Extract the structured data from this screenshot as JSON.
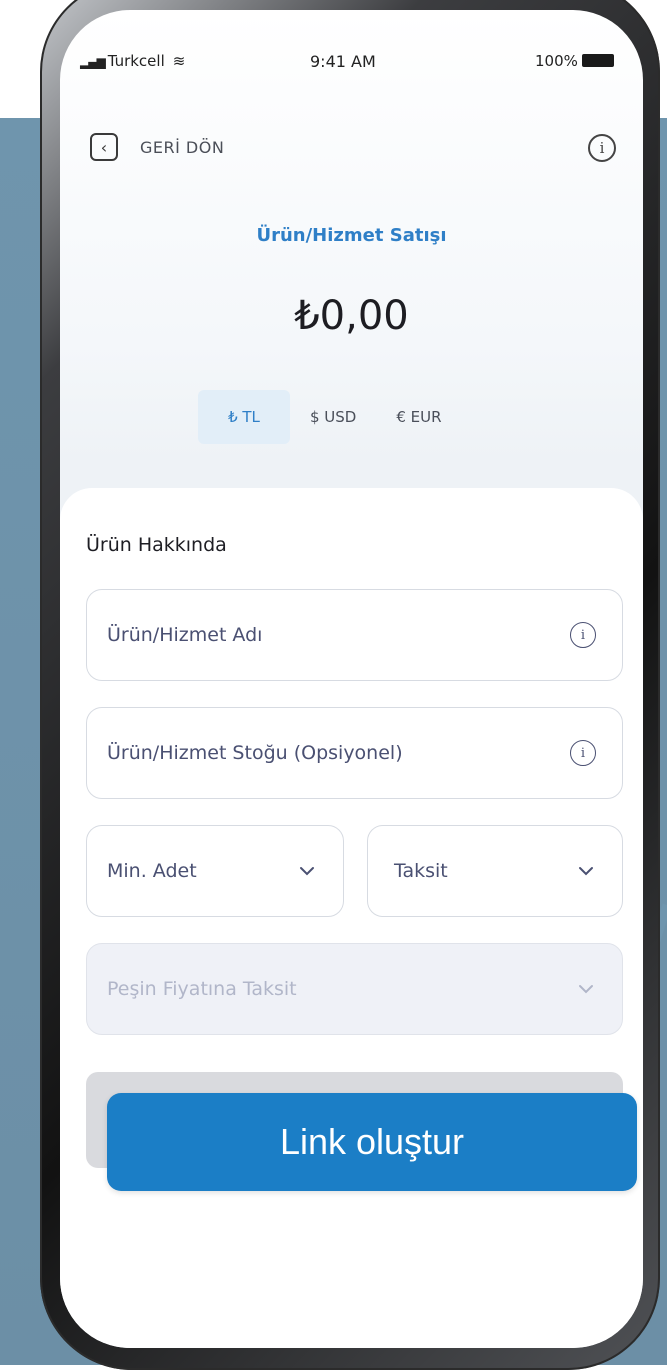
{
  "status_bar": {
    "carrier": "Turkcell",
    "time": "9:41 AM",
    "battery": "100%"
  },
  "header": {
    "back_label": "GERİ DÖN",
    "back_icon": "chevron-left-icon",
    "info_icon": "info-icon"
  },
  "sale": {
    "title": "Ürün/Hizmet Satışı",
    "amount": "₺0,00"
  },
  "currency_tabs": [
    {
      "label": "₺ TL",
      "active": true
    },
    {
      "label": "$ USD",
      "active": false
    },
    {
      "label": "€ EUR",
      "active": false
    }
  ],
  "form": {
    "section_title": "Ürün Hakkında",
    "product_name_placeholder": "Ürün/Hizmet Adı",
    "stock_placeholder": "Ürün/Hizmet Stoğu (Opsiyonel)",
    "min_quantity_label": "Min. Adet",
    "installment_label": "Taksit",
    "cash_price_installment_label": "Peşin Fiyatına Taksit"
  },
  "cta": {
    "label": "Link oluştur"
  },
  "colors": {
    "accent": "#2f7fc7",
    "cta": "#1b7ec6",
    "backdrop": "#6f95ad"
  }
}
